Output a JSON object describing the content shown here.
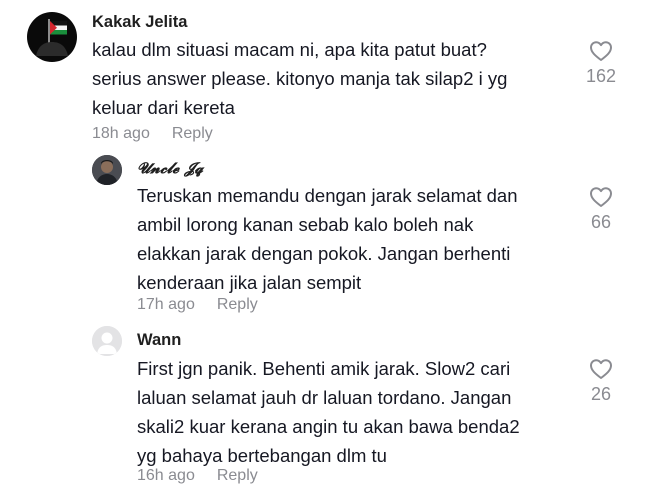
{
  "comments": [
    {
      "author": "Kakak Jelita",
      "text_lines": [
        "kalau dlm situasi macam ni, apa kita patut buat?",
        "serius answer please. kitonyo manja tak silap2 i yg",
        "keluar dari kereta"
      ],
      "time": "18h ago",
      "reply_label": "Reply",
      "likes": "162"
    },
    {
      "author": "𝓤𝓷𝓬𝓵𝓮 𝓙𝓺",
      "text_lines": [
        "Teruskan memandu dengan jarak selamat dan",
        "ambil lorong kanan sebab kalo boleh nak",
        "elakkan jarak dengan pokok. Jangan berhenti",
        "kenderaan jika jalan sempit"
      ],
      "time": "17h ago",
      "reply_label": "Reply",
      "likes": "66"
    },
    {
      "author": "Wann",
      "text_lines": [
        "First jgn panik. Behenti amik jarak. Slow2 cari",
        "laluan selamat jauh dr laluan tordano. Jangan",
        "skali2 kuar kerana angin tu akan bawa benda2",
        "yg bahaya bertebangan dlm tu"
      ],
      "time": "16h ago",
      "reply_label": "Reply",
      "likes": "26"
    }
  ],
  "icons": {
    "like": "heart-outline-icon"
  },
  "colors": {
    "text": "#161823",
    "muted": "#8a8b91"
  }
}
